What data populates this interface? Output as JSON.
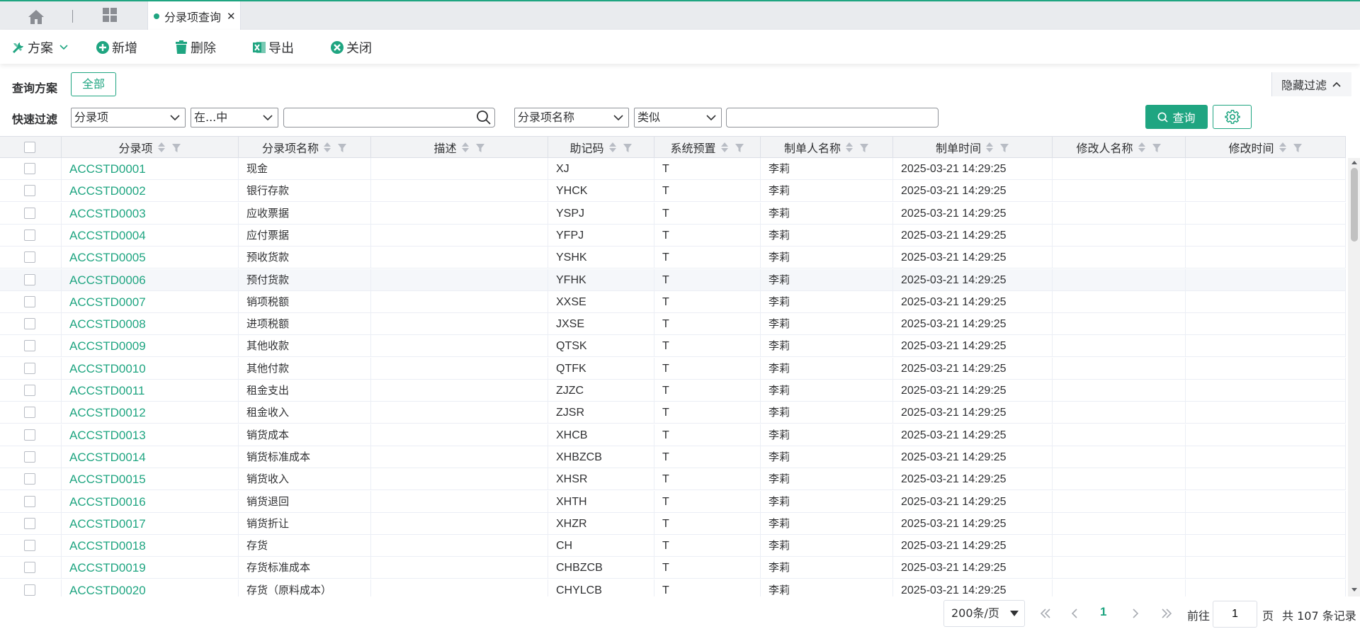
{
  "tabs": {
    "active_label": "分录项查询"
  },
  "toolbar": {
    "scheme_label": "方案",
    "add_label": "新增",
    "delete_label": "删除",
    "export_label": "导出",
    "close_label": "关闭"
  },
  "filter": {
    "scheme_label": "查询方案",
    "all_button": "全部",
    "hide_filter": "隐藏过滤",
    "quick_label": "快速过滤",
    "field1": "分录项",
    "op1": "在...中",
    "value1": "",
    "field2": "分录项名称",
    "op2": "类似",
    "value2": "",
    "query_button": "查询"
  },
  "table": {
    "columns": [
      "分录项",
      "分录项名称",
      "描述",
      "助记码",
      "系统预置",
      "制单人名称",
      "制单时间",
      "修改人名称",
      "修改时间"
    ],
    "rows": [
      [
        "ACCSTD0001",
        "现金",
        "",
        "XJ",
        "T",
        "李莉",
        "2025-03-21 14:29:25",
        "",
        ""
      ],
      [
        "ACCSTD0002",
        "银行存款",
        "",
        "YHCK",
        "T",
        "李莉",
        "2025-03-21 14:29:25",
        "",
        ""
      ],
      [
        "ACCSTD0003",
        "应收票据",
        "",
        "YSPJ",
        "T",
        "李莉",
        "2025-03-21 14:29:25",
        "",
        ""
      ],
      [
        "ACCSTD0004",
        "应付票据",
        "",
        "YFPJ",
        "T",
        "李莉",
        "2025-03-21 14:29:25",
        "",
        ""
      ],
      [
        "ACCSTD0005",
        "预收货款",
        "",
        "YSHK",
        "T",
        "李莉",
        "2025-03-21 14:29:25",
        "",
        ""
      ],
      [
        "ACCSTD0006",
        "预付货款",
        "",
        "YFHK",
        "T",
        "李莉",
        "2025-03-21 14:29:25",
        "",
        ""
      ],
      [
        "ACCSTD0007",
        "销项税额",
        "",
        "XXSE",
        "T",
        "李莉",
        "2025-03-21 14:29:25",
        "",
        ""
      ],
      [
        "ACCSTD0008",
        "进项税额",
        "",
        "JXSE",
        "T",
        "李莉",
        "2025-03-21 14:29:25",
        "",
        ""
      ],
      [
        "ACCSTD0009",
        "其他收款",
        "",
        "QTSK",
        "T",
        "李莉",
        "2025-03-21 14:29:25",
        "",
        ""
      ],
      [
        "ACCSTD0010",
        "其他付款",
        "",
        "QTFK",
        "T",
        "李莉",
        "2025-03-21 14:29:25",
        "",
        ""
      ],
      [
        "ACCSTD0011",
        "租金支出",
        "",
        "ZJZC",
        "T",
        "李莉",
        "2025-03-21 14:29:25",
        "",
        ""
      ],
      [
        "ACCSTD0012",
        "租金收入",
        "",
        "ZJSR",
        "T",
        "李莉",
        "2025-03-21 14:29:25",
        "",
        ""
      ],
      [
        "ACCSTD0013",
        "销货成本",
        "",
        "XHCB",
        "T",
        "李莉",
        "2025-03-21 14:29:25",
        "",
        ""
      ],
      [
        "ACCSTD0014",
        "销货标准成本",
        "",
        "XHBZCB",
        "T",
        "李莉",
        "2025-03-21 14:29:25",
        "",
        ""
      ],
      [
        "ACCSTD0015",
        "销货收入",
        "",
        "XHSR",
        "T",
        "李莉",
        "2025-03-21 14:29:25",
        "",
        ""
      ],
      [
        "ACCSTD0016",
        "销货退回",
        "",
        "XHTH",
        "T",
        "李莉",
        "2025-03-21 14:29:25",
        "",
        ""
      ],
      [
        "ACCSTD0017",
        "销货折让",
        "",
        "XHZR",
        "T",
        "李莉",
        "2025-03-21 14:29:25",
        "",
        ""
      ],
      [
        "ACCSTD0018",
        "存货",
        "",
        "CH",
        "T",
        "李莉",
        "2025-03-21 14:29:25",
        "",
        ""
      ],
      [
        "ACCSTD0019",
        "存货标准成本",
        "",
        "CHBZCB",
        "T",
        "李莉",
        "2025-03-21 14:29:25",
        "",
        ""
      ],
      [
        "ACCSTD0020",
        "存货（原料成本）",
        "",
        "CHYLCB",
        "T",
        "李莉",
        "2025-03-21 14:29:25",
        "",
        ""
      ]
    ],
    "highlighted_row": 5
  },
  "pager": {
    "page_size": "200条/页",
    "current_page": "1",
    "goto_label": "前往",
    "goto_value": "1",
    "page_unit": "页",
    "total_text": "共 107 条记录"
  },
  "colors": {
    "accent": "#1fa581",
    "header_bg": "#f2f3f5",
    "tab_bg": "#e9ebee"
  },
  "icons": [
    "home-icon",
    "grid-icon",
    "tools-icon",
    "plus-circle-icon",
    "trash-icon",
    "excel-icon",
    "close-circle-icon",
    "search-icon",
    "gear-icon",
    "sort-icon",
    "filter-icon"
  ]
}
